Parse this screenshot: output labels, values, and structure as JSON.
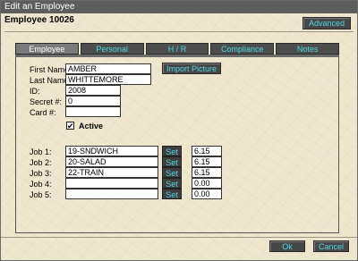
{
  "window": {
    "title": "Edit an Employee"
  },
  "header": {
    "employee_label": "Employee 10026",
    "advanced_button": "Advanced"
  },
  "tabs": [
    {
      "label": "Employee",
      "active": true
    },
    {
      "label": "Personal",
      "active": false
    },
    {
      "label": "H / R",
      "active": false
    },
    {
      "label": "Compliance",
      "active": false
    },
    {
      "label": "Notes",
      "active": false
    }
  ],
  "form": {
    "first_name_label": "First Name:",
    "first_name": "AMBER",
    "last_name_label": "Last Name:",
    "last_name": "WHITTEMORE",
    "id_label": "ID:",
    "id": "2008",
    "secret_label": "Secret #:",
    "secret": "0",
    "card_label": "Card #:",
    "card": "",
    "active_label": "Active",
    "active_checked": true,
    "active_mark": "✔",
    "import_picture_button": "Import Picture"
  },
  "jobs": [
    {
      "label": "Job 1:",
      "value": "19-SNDWICH",
      "set": "Set",
      "rate": "6.15"
    },
    {
      "label": "Job 2:",
      "value": "20-SALAD",
      "set": "Set",
      "rate": "6.15"
    },
    {
      "label": "Job 3:",
      "value": "22-TRAIN",
      "set": "Set",
      "rate": "6.15"
    },
    {
      "label": "Job 4:",
      "value": "",
      "set": "Set",
      "rate": "0.00"
    },
    {
      "label": "Job 5:",
      "value": "",
      "set": "Set",
      "rate": "0.00"
    }
  ],
  "footer": {
    "ok_button": "Ok",
    "cancel_button": "Cancel"
  },
  "colors": {
    "accent_text": "#4fd8e0",
    "button_bg": "#474747",
    "background": "#efe6cf",
    "titlebar": "#5d5d5d"
  }
}
